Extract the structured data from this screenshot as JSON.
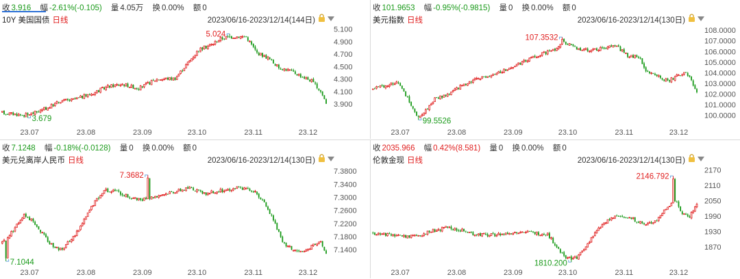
{
  "panels": [
    {
      "stats": {
        "close_label": "收",
        "close_value": "3.916",
        "change_label": "幅",
        "change_value": "-2.61%(-0.105)",
        "volume_label": "量",
        "volume_value": "4.05万",
        "turnover_label": "换",
        "turnover_value": "0.00%",
        "amount_label": "额",
        "amount_value": "0"
      },
      "name": "10Y 美国国债",
      "period": "日线",
      "range": "2023/06/16-2023/12/14(144日)",
      "change_direction": "down"
    },
    {
      "stats": {
        "close_label": "收",
        "close_value": "101.9653",
        "change_label": "幅",
        "change_value": "-0.95%(-0.9815)",
        "volume_label": "量",
        "volume_value": "0",
        "turnover_label": "换",
        "turnover_value": "0.00%",
        "amount_label": "额",
        "amount_value": "0"
      },
      "name": "美元指数",
      "period": "日线",
      "range": "2023/06/16-2023/12/14(130日)",
      "change_direction": "down"
    },
    {
      "stats": {
        "close_label": "收",
        "close_value": "7.1248",
        "change_label": "幅",
        "change_value": "-0.18%(-0.0128)",
        "volume_label": "量",
        "volume_value": "0",
        "turnover_label": "换",
        "turnover_value": "0.00%",
        "amount_label": "额",
        "amount_value": "0"
      },
      "name": "美元兑离岸人民币",
      "period": "日线",
      "range": "2023/06/16-2023/12/14(130日)",
      "change_direction": "down"
    },
    {
      "stats": {
        "close_label": "收",
        "close_value": "2035.966",
        "change_label": "幅",
        "change_value": "0.42%(8.581)",
        "volume_label": "量",
        "volume_value": "0",
        "turnover_label": "换",
        "turnover_value": "0.00%",
        "amount_label": "额",
        "amount_value": "0"
      },
      "name": "伦敦金现",
      "period": "日线",
      "range": "2023/06/16-2023/12/14(130日)",
      "change_direction": "up"
    }
  ],
  "colors": {
    "up": "#e02020",
    "down": "#1a9a1a",
    "axis_text": "#555555",
    "marker": "#6aa6e0",
    "accent": "#2b6fd6"
  },
  "chart_data": [
    {
      "type": "candlestick",
      "title": "10Y 美国国债",
      "ylim": [
        3.55,
        5.15
      ],
      "y_ticks": [
        "5.100",
        "4.900",
        "4.700",
        "4.500",
        "4.300",
        "4.100",
        "3.900"
      ],
      "x_ticks": [
        "23.07",
        "23.08",
        "23.09",
        "23.10",
        "23.11",
        "23.12"
      ],
      "x_tick_positions": [
        15,
        46,
        77,
        107,
        138,
        168
      ],
      "n": 180,
      "last_index": 178,
      "keypoints": [
        [
          0,
          3.76
        ],
        [
          12,
          3.72
        ],
        [
          18,
          3.76
        ],
        [
          25,
          3.84
        ],
        [
          32,
          3.95
        ],
        [
          38,
          3.96
        ],
        [
          48,
          4.05
        ],
        [
          58,
          4.18
        ],
        [
          66,
          4.22
        ],
        [
          75,
          4.15
        ],
        [
          85,
          4.3
        ],
        [
          95,
          4.31
        ],
        [
          102,
          4.56
        ],
        [
          108,
          4.77
        ],
        [
          115,
          4.85
        ],
        [
          120,
          4.95
        ],
        [
          127,
          4.98
        ],
        [
          134,
          4.98
        ],
        [
          140,
          4.72
        ],
        [
          146,
          4.64
        ],
        [
          152,
          4.48
        ],
        [
          158,
          4.44
        ],
        [
          164,
          4.35
        ],
        [
          170,
          4.27
        ],
        [
          175,
          4.1
        ],
        [
          178,
          3.92
        ]
      ],
      "high_label": "5.024",
      "high_value": 5.024,
      "high_index": 125,
      "low_label": "3.679",
      "low_value": 3.679,
      "low_index": 14
    },
    {
      "type": "candlestick",
      "title": "美元指数",
      "ylim": [
        99.0,
        108.4
      ],
      "y_ticks": [
        "108.0000",
        "107.0000",
        "106.0000",
        "105.0000",
        "104.0000",
        "103.0000",
        "102.0000",
        "101.0000",
        "100.0000"
      ],
      "x_ticks": [
        "23.07",
        "23.08",
        "23.09",
        "23.10",
        "23.11",
        "23.12"
      ],
      "x_tick_positions": [
        15,
        46,
        77,
        107,
        138,
        168
      ],
      "n": 180,
      "last_index": 178,
      "keypoints": [
        [
          0,
          102.5
        ],
        [
          8,
          102.8
        ],
        [
          14,
          103.2
        ],
        [
          20,
          101.3
        ],
        [
          24,
          99.8
        ],
        [
          28,
          100.2
        ],
        [
          34,
          101.5
        ],
        [
          42,
          102.0
        ],
        [
          50,
          102.9
        ],
        [
          60,
          103.6
        ],
        [
          70,
          104.1
        ],
        [
          80,
          104.8
        ],
        [
          90,
          105.6
        ],
        [
          100,
          106.2
        ],
        [
          104,
          107.0
        ],
        [
          110,
          106.4
        ],
        [
          118,
          106.1
        ],
        [
          126,
          106.3
        ],
        [
          134,
          106.5
        ],
        [
          140,
          105.6
        ],
        [
          146,
          105.5
        ],
        [
          150,
          104.2
        ],
        [
          156,
          103.8
        ],
        [
          162,
          103.2
        ],
        [
          168,
          103.8
        ],
        [
          172,
          104.0
        ],
        [
          175,
          103.4
        ],
        [
          178,
          102.0
        ]
      ],
      "high_label": "107.3532",
      "high_value": 107.3532,
      "high_index": 104,
      "low_label": "99.5526",
      "low_value": 99.5526,
      "low_index": 25
    },
    {
      "type": "candlestick",
      "title": "美元兑离岸人民币",
      "ylim": [
        7.09,
        7.395
      ],
      "y_ticks": [
        "7.3800",
        "7.3400",
        "7.3000",
        "7.2600",
        "7.2200",
        "7.1800",
        "7.1400"
      ],
      "x_ticks": [
        "23.07",
        "23.08",
        "23.09",
        "23.10",
        "23.11",
        "23.12"
      ],
      "x_tick_positions": [
        15,
        46,
        77,
        107,
        138,
        168
      ],
      "n": 180,
      "last_index": 178,
      "keypoints": [
        [
          0,
          7.16
        ],
        [
          6,
          7.2
        ],
        [
          12,
          7.25
        ],
        [
          18,
          7.22
        ],
        [
          26,
          7.16
        ],
        [
          32,
          7.14
        ],
        [
          38,
          7.17
        ],
        [
          44,
          7.22
        ],
        [
          50,
          7.28
        ],
        [
          56,
          7.32
        ],
        [
          62,
          7.32
        ],
        [
          70,
          7.3
        ],
        [
          76,
          7.29
        ],
        [
          82,
          7.3
        ],
        [
          88,
          7.31
        ],
        [
          96,
          7.32
        ],
        [
          104,
          7.33
        ],
        [
          110,
          7.31
        ],
        [
          120,
          7.32
        ],
        [
          130,
          7.33
        ],
        [
          138,
          7.32
        ],
        [
          144,
          7.28
        ],
        [
          150,
          7.22
        ],
        [
          154,
          7.16
        ],
        [
          160,
          7.14
        ],
        [
          166,
          7.13
        ],
        [
          172,
          7.16
        ],
        [
          175,
          7.16
        ],
        [
          178,
          7.125
        ]
      ],
      "high_label": "7.3682",
      "high_value": 7.3682,
      "high_index": 80,
      "low_label": "7.1044",
      "low_value": 7.1044,
      "low_index": 2
    },
    {
      "type": "candlestick",
      "title": "伦敦金现",
      "ylim": [
        1795,
        2185
      ],
      "y_ticks": [
        "2170",
        "2110",
        "2050",
        "1990",
        "1930",
        "1870"
      ],
      "x_ticks": [
        "23.07",
        "23.08",
        "23.09",
        "23.10",
        "23.11",
        "23.12"
      ],
      "x_tick_positions": [
        15,
        46,
        77,
        107,
        138,
        168
      ],
      "n": 180,
      "last_index": 178,
      "keypoints": [
        [
          0,
          1925
        ],
        [
          8,
          1915
        ],
        [
          16,
          1910
        ],
        [
          24,
          1912
        ],
        [
          32,
          1930
        ],
        [
          40,
          1945
        ],
        [
          48,
          1935
        ],
        [
          56,
          1920
        ],
        [
          64,
          1915
        ],
        [
          72,
          1920
        ],
        [
          80,
          1930
        ],
        [
          88,
          1925
        ],
        [
          96,
          1920
        ],
        [
          100,
          1880
        ],
        [
          104,
          1840
        ],
        [
          108,
          1825
        ],
        [
          112,
          1830
        ],
        [
          116,
          1860
        ],
        [
          120,
          1905
        ],
        [
          126,
          1955
        ],
        [
          132,
          1985
        ],
        [
          138,
          1990
        ],
        [
          144,
          1975
        ],
        [
          150,
          1955
        ],
        [
          156,
          1975
        ],
        [
          162,
          2030
        ],
        [
          166,
          2050
        ],
        [
          170,
          2000
        ],
        [
          174,
          1990
        ],
        [
          178,
          2036
        ]
      ],
      "high_label": "2146.792",
      "high_value": 2146.792,
      "high_index": 165,
      "low_label": "1810.200",
      "low_value": 1810.2,
      "low_index": 109
    }
  ]
}
